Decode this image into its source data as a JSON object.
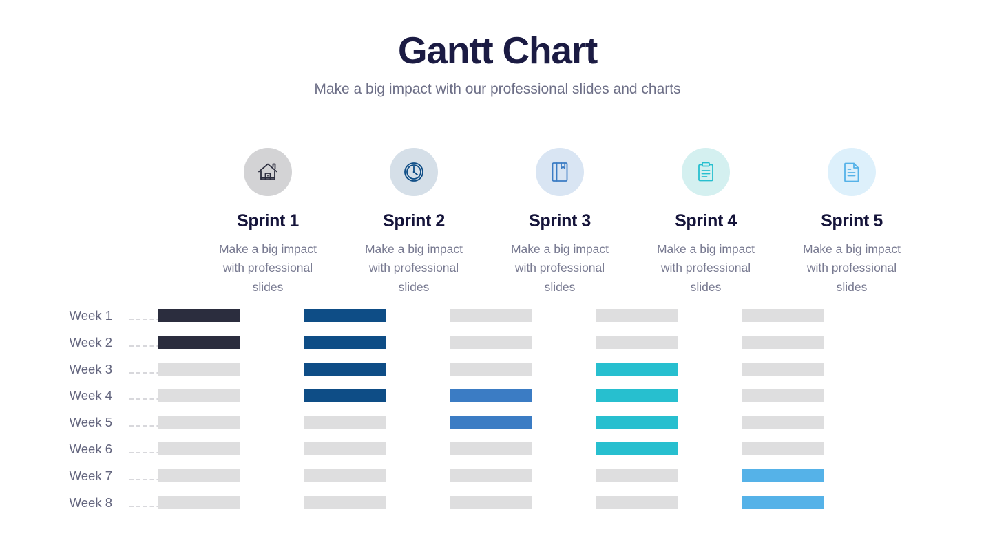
{
  "header": {
    "title": "Gantt Chart",
    "subtitle": "Make a big impact with our professional slides and charts"
  },
  "sprints": [
    {
      "name": "Sprint 1",
      "description": "Make a big impact with professional slides",
      "icon": "house-icon",
      "circle_color": "#d3d3d5",
      "icon_color": "#2b2d3e"
    },
    {
      "name": "Sprint 2",
      "description": "Make a big impact with professional slides",
      "icon": "clock-icon",
      "circle_color": "#d5dfe8",
      "icon_color": "#0e4d86"
    },
    {
      "name": "Sprint 3",
      "description": "Make a big impact with professional slides",
      "icon": "book-icon",
      "circle_color": "#d9e5f3",
      "icon_color": "#3b7cc4"
    },
    {
      "name": "Sprint 4",
      "description": "Make a big impact with professional slides",
      "icon": "clipboard-icon",
      "circle_color": "#d4f0f0",
      "icon_color": "#27bfcf"
    },
    {
      "name": "Sprint 5",
      "description": "Make a big impact with professional slides",
      "icon": "document-icon",
      "circle_color": "#ddf0fb",
      "icon_color": "#55b2e8"
    }
  ],
  "chart_data": {
    "type": "bar",
    "chart_kind": "gantt",
    "title": "Gantt Chart",
    "subtitle": "Make a big impact with our professional slides and charts",
    "xlabel": "",
    "ylabel": "",
    "categories": [
      "Week 1",
      "Week 2",
      "Week 3",
      "Week 4",
      "Week 5",
      "Week 6",
      "Week 7",
      "Week 8"
    ],
    "inactive_color": "#dededf",
    "series": [
      {
        "name": "Sprint 1",
        "color": "#2b2d3e",
        "active_weeks": [
          "Week 1",
          "Week 2"
        ],
        "values": [
          1,
          1,
          0,
          0,
          0,
          0,
          0,
          0
        ]
      },
      {
        "name": "Sprint 2",
        "color": "#0e4d86",
        "active_weeks": [
          "Week 1",
          "Week 2",
          "Week 3",
          "Week 4"
        ],
        "values": [
          1,
          1,
          1,
          1,
          0,
          0,
          0,
          0
        ]
      },
      {
        "name": "Sprint 3",
        "color": "#3b7cc4",
        "active_weeks": [
          "Week 4",
          "Week 5"
        ],
        "values": [
          0,
          0,
          0,
          1,
          1,
          0,
          0,
          0
        ]
      },
      {
        "name": "Sprint 4",
        "color": "#27bfcf",
        "active_weeks": [
          "Week 3",
          "Week 4",
          "Week 5",
          "Week 6"
        ],
        "values": [
          0,
          0,
          1,
          1,
          1,
          1,
          0,
          0
        ]
      },
      {
        "name": "Sprint 5",
        "color": "#55b2e8",
        "active_weeks": [
          "Week 7",
          "Week 8"
        ],
        "values": [
          0,
          0,
          0,
          0,
          0,
          0,
          1,
          1
        ]
      }
    ],
    "legend_position": "top",
    "grid": false
  }
}
